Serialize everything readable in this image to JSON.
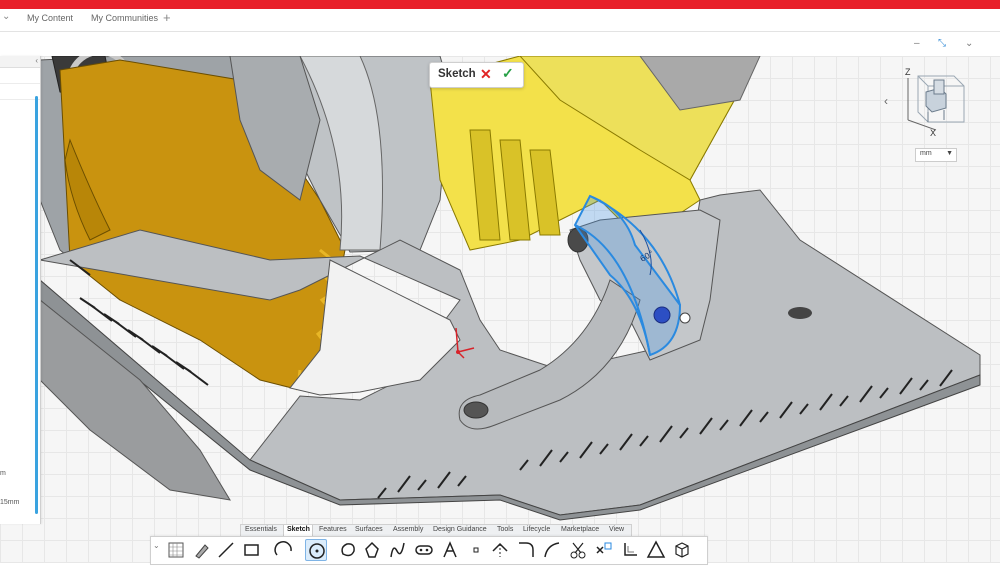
{
  "app": {
    "brand_color": "#e8202a"
  },
  "tabs": [
    {
      "label": "My Content"
    },
    {
      "label": "My Communities"
    }
  ],
  "tab_add_glyph": "+",
  "sketch_popup": {
    "label": "Sketch",
    "cancel_icon": "close-icon",
    "confirm_icon": "check-icon"
  },
  "viewcube": {
    "z_label": "Z",
    "x_label": "X"
  },
  "units": {
    "value": "mm"
  },
  "left_panel": {
    "partial_texts": [
      "m",
      "15mm"
    ]
  },
  "dimension": {
    "angle": "60°"
  },
  "ribbon_tabs": [
    {
      "label": "Essentials"
    },
    {
      "label": "Sketch"
    },
    {
      "label": "Features"
    },
    {
      "label": "Surfaces"
    },
    {
      "label": "Assembly"
    },
    {
      "label": "Design Guidance"
    },
    {
      "label": "Tools"
    },
    {
      "label": "Lifecycle"
    },
    {
      "label": "Marketplace"
    },
    {
      "label": "View"
    }
  ],
  "active_ribbon_tab": "Sketch",
  "toolbar_tools": [
    "grid-icon",
    "pencil-icon",
    "line-icon",
    "rectangle-icon",
    "arc-icon",
    "circle-icon",
    "polygon-icon",
    "spline-icon",
    "slot-icon",
    "text-icon",
    "point-icon",
    "trim-icon",
    "fillet-icon",
    "offset-icon",
    "cut-icon",
    "constraint-icon",
    "project-icon",
    "triangle-icon",
    "cube-icon"
  ]
}
